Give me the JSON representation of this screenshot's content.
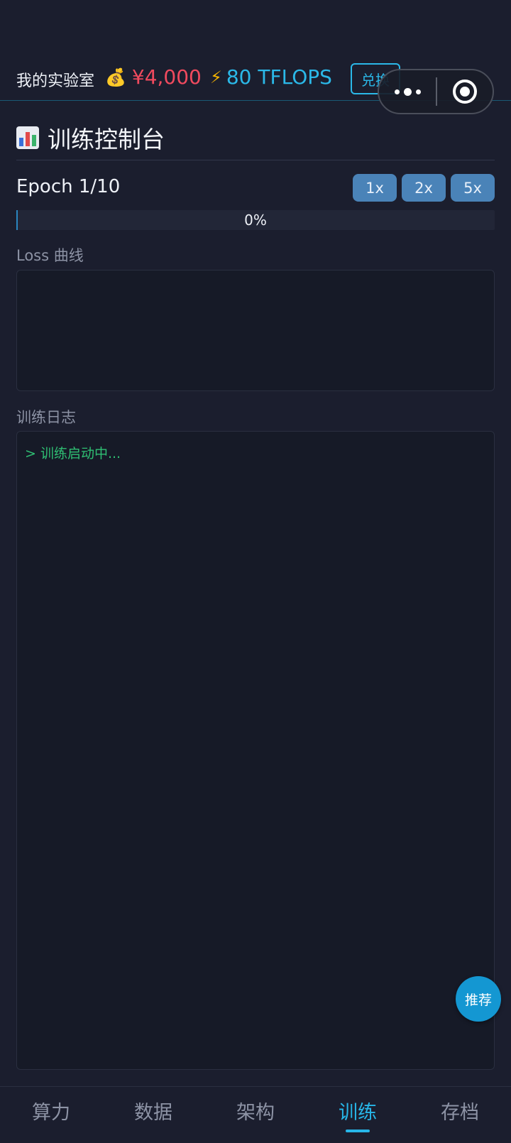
{
  "header": {
    "lab_title": "我的实验室",
    "money_icon": "money-bag-icon",
    "money": "¥4,000",
    "compute_icon": "lightning-icon",
    "compute": "80 TFLOPS",
    "exchange_label": "兑换"
  },
  "capsule": {
    "more_icon": "more-dots-icon",
    "close_icon": "target-circle-icon"
  },
  "console": {
    "title": "训练控制台",
    "icon": "bar-chart-icon",
    "epoch": "Epoch 1/10",
    "speeds": [
      "1x",
      "2x",
      "5x"
    ],
    "progress": 0,
    "progress_text": "0%",
    "loss_label": "Loss 曲线",
    "log_label": "训练日志",
    "log_lines": [
      "> 训练启动中..."
    ]
  },
  "recommend_label": "推荐",
  "nav": {
    "items": [
      "算力",
      "数据",
      "架构",
      "训练",
      "存档"
    ],
    "active": 3
  },
  "colors": {
    "background": "#1b1e2e",
    "accent": "#27b6e8",
    "money": "#f04a5e",
    "log_green": "#2fbf73"
  }
}
